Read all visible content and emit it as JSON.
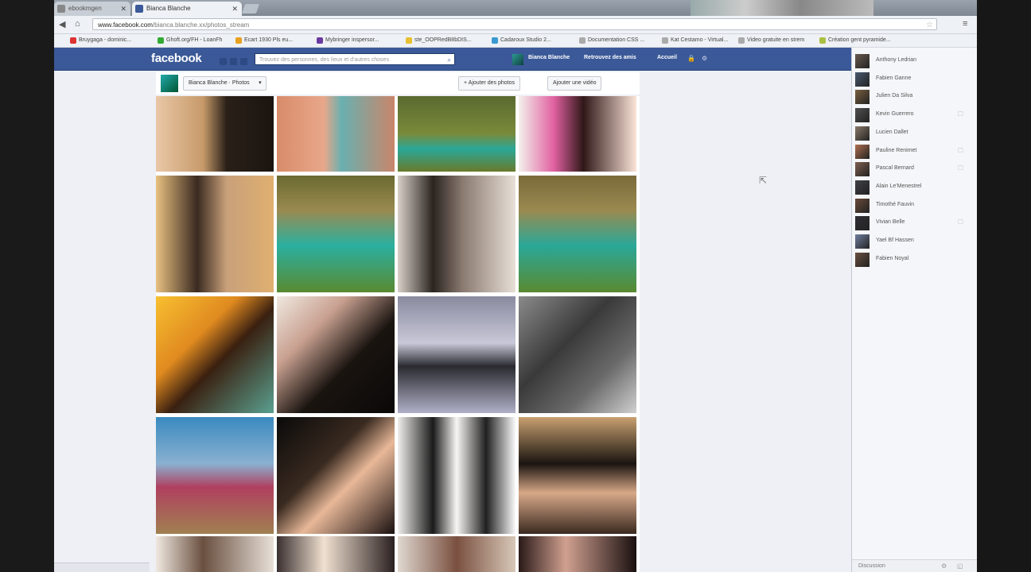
{
  "browser": {
    "tabs": [
      {
        "title": "ebookmgen"
      },
      {
        "title": "Bianca Blanche"
      }
    ],
    "url_host": "www.facebook.com",
    "url_rest": "/bianca.blanche.xx/photos_stream",
    "bookmarks": [
      {
        "label": "Bruygaga - dominic...",
        "color": "#d33"
      },
      {
        "label": "Ghoft.org/FH - LoanFh",
        "color": "#3a3"
      },
      {
        "label": "Ecart 1930 Pls eu...",
        "color": "#e8a020"
      },
      {
        "label": "Mybringer inspersor...",
        "color": "#6a3aa0"
      },
      {
        "label": "ste_OOPRedB8bDIS...",
        "color": "#e8c030"
      },
      {
        "label": "Cadaroux Studio 2...",
        "color": "#3a9ad0"
      },
      {
        "label": "Documentation CSS ...",
        "color": "#aaa"
      },
      {
        "label": "Kat Cestamo - Virtual...",
        "color": "#aaa"
      },
      {
        "label": "Video gratuite en strem",
        "color": "#aaa"
      },
      {
        "label": "Création gent pyramide...",
        "color": "#aac040"
      }
    ]
  },
  "fb": {
    "logo": "facebook",
    "search_placeholder": "Trouvez des personnes, des lieux et d'autres choses",
    "profile_name": "Bianca Blanche",
    "find_friends": "Retrouvez des amis",
    "home": "Accueil"
  },
  "page": {
    "crumb": "Bianca Blanche · Photos",
    "add_photos": "+ Ajouter des photos",
    "add_video": "Ajouter une vidéo"
  },
  "chat": {
    "friends": [
      {
        "name": "Anthony Ledrian",
        "tone": "#6a5a50",
        "phone": false
      },
      {
        "name": "Fabien Ganne",
        "tone": "#4a5a70",
        "phone": false
      },
      {
        "name": "Julien Da Silva",
        "tone": "#7a6040",
        "phone": false
      },
      {
        "name": "Kevin Guerrero",
        "tone": "#505050",
        "phone": true
      },
      {
        "name": "Lucien Dallet",
        "tone": "#8a7a6a",
        "phone": false
      },
      {
        "name": "Pauline Renimet",
        "tone": "#b07050",
        "phone": true
      },
      {
        "name": "Pascal Bernard",
        "tone": "#806050",
        "phone": true
      },
      {
        "name": "Alain Le'Menestrel",
        "tone": "#404048",
        "phone": false
      },
      {
        "name": "Timothé Fauvin",
        "tone": "#6a4a3a",
        "phone": false
      },
      {
        "name": "Vivian Belle",
        "tone": "#303035",
        "phone": true
      },
      {
        "name": "Yael Bf Hassen",
        "tone": "#7080a0",
        "phone": false
      },
      {
        "name": "Fabien Noyal",
        "tone": "#6a5040",
        "phone": false
      }
    ],
    "footer": "Discussion"
  },
  "photos": [
    {
      "bg": "linear-gradient(90deg,#e9c7a7 0%,#c79a6a 40%,#2a2018 60%,#1a1410 100%)"
    },
    {
      "bg": "linear-gradient(90deg,#d88c6a,#e8a78a 40%,#6ab0b0 55%,#c9856a)"
    },
    {
      "bg": "linear-gradient(180deg,#5a6a30,#7a8a3a 50%,#2aa898 70%,#6a7a2a)"
    },
    {
      "bg": "linear-gradient(90deg,#f4f0ec,#e060a0 30%,#301818 55%,#fbe4d8)"
    },
    {
      "bg": "linear-gradient(90deg,#e8c080,#3a2a20 35%,#c8a07a 60%,#e0b070)"
    },
    {
      "bg": "linear-gradient(180deg,#6a6a30,#9a8a50 30%,#2ab0a0 60%,#5a8a30)"
    },
    {
      "bg": "linear-gradient(90deg,#d8d0c8,#2a2420 30%,#8a7a70 55%,#e8e0d8)"
    },
    {
      "bg": "linear-gradient(180deg,#7a6a3a,#9a8a50 30%,#2aa898 60%,#5a8a30)"
    },
    {
      "bg": "linear-gradient(135deg,#f8c030,#e08a20 35%,#3a2010 55%,#5aa090)"
    },
    {
      "bg": "linear-gradient(135deg,#f0e8e0,#c8a090 30%,#1a1410 60%,#0a0808)"
    },
    {
      "bg": "linear-gradient(180deg,#8a8aa0,#c8c8d8 40%,#2a2a30 60%,#b0b0c8)"
    },
    {
      "bg": "linear-gradient(135deg,#8a8a8a,#3a3a3a 40%,#6a6a6a 70%,#d0d0d0)"
    },
    {
      "bg": "linear-gradient(180deg,#3a8ac0,#8ab0d0 40%,#b04060 60%,#a08050)"
    },
    {
      "bg": "linear-gradient(135deg,#0a0a0a,#3a2a20 40%,#e8b898 60%,#1a1010)"
    },
    {
      "bg": "linear-gradient(90deg,#f0eeec,#1a1a1a 30%,#f8f6f4 50%,#202020 75%,#fafafa)"
    },
    {
      "bg": "linear-gradient(180deg,#c8a070,#1a1410 40%,#d8a888 65%,#3a2a20)"
    },
    {
      "bg": "linear-gradient(90deg,#f0e8e0,#6a5040 40%,#e8e0d8)"
    },
    {
      "bg": "linear-gradient(90deg,#3a3030,#f0e0d0 40%,#2a2020)"
    },
    {
      "bg": "linear-gradient(90deg,#e0d8d0,#7a5040 50%,#d8c8b8)"
    },
    {
      "bg": "linear-gradient(90deg,#2a1a18,#d0a090 40%,#1a1010)"
    }
  ]
}
